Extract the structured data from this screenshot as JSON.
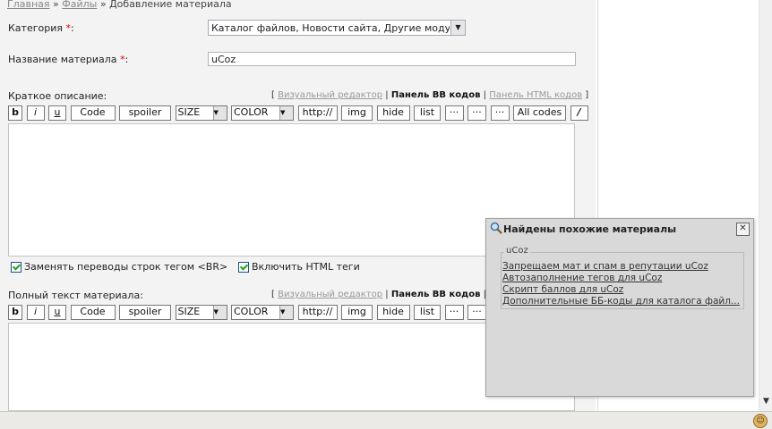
{
  "breadcrumb": {
    "home": "Главная",
    "sep1": "»",
    "files": "Файлы",
    "sep2": "»",
    "current": "Добавление материала"
  },
  "form": {
    "category_label": "Категория",
    "required_mark": "*",
    "colon": ":",
    "category_value": "Каталог файлов, Новости сайта, Другие моду...",
    "title_label": "Название материала",
    "title_value": "uCoz",
    "short_label": "Краткое описание:",
    "full_label": "Полный текст материала:"
  },
  "editor_modes": {
    "visual": "Визуальный редактор",
    "bb": "Панель BB кодов",
    "html": "Панель HTML кодов",
    "open": "[",
    "pipe": "|",
    "close": "]"
  },
  "toolbar": {
    "bold": "b",
    "italic": "i",
    "underline": "u",
    "code": "Code",
    "spoiler": "spoiler",
    "size": "SIZE",
    "color": "COLOR",
    "url": "http://",
    "img": "img",
    "hide": "hide",
    "list": "list",
    "more1": "···",
    "more2": "···",
    "more3": "···",
    "all_codes": "All codes",
    "slash": "/"
  },
  "options": {
    "replace_br": "Заменять переводы строк тегом <BR>",
    "enable_html": "Включить HTML теги"
  },
  "popup": {
    "title": "Найдены похожие материалы",
    "group": "uCoz",
    "close": "✕",
    "items": [
      "Запрещаем мат и спам в репутации uCoz",
      "Автозаполнение тегов для uCoz",
      "Скрипт баллов для uCoz",
      "Дополнительные ББ-коды для каталога файл..."
    ]
  },
  "icons": {
    "dropdown": "triangle-down",
    "search": "magnifier-icon",
    "status": "smiley-icon"
  }
}
